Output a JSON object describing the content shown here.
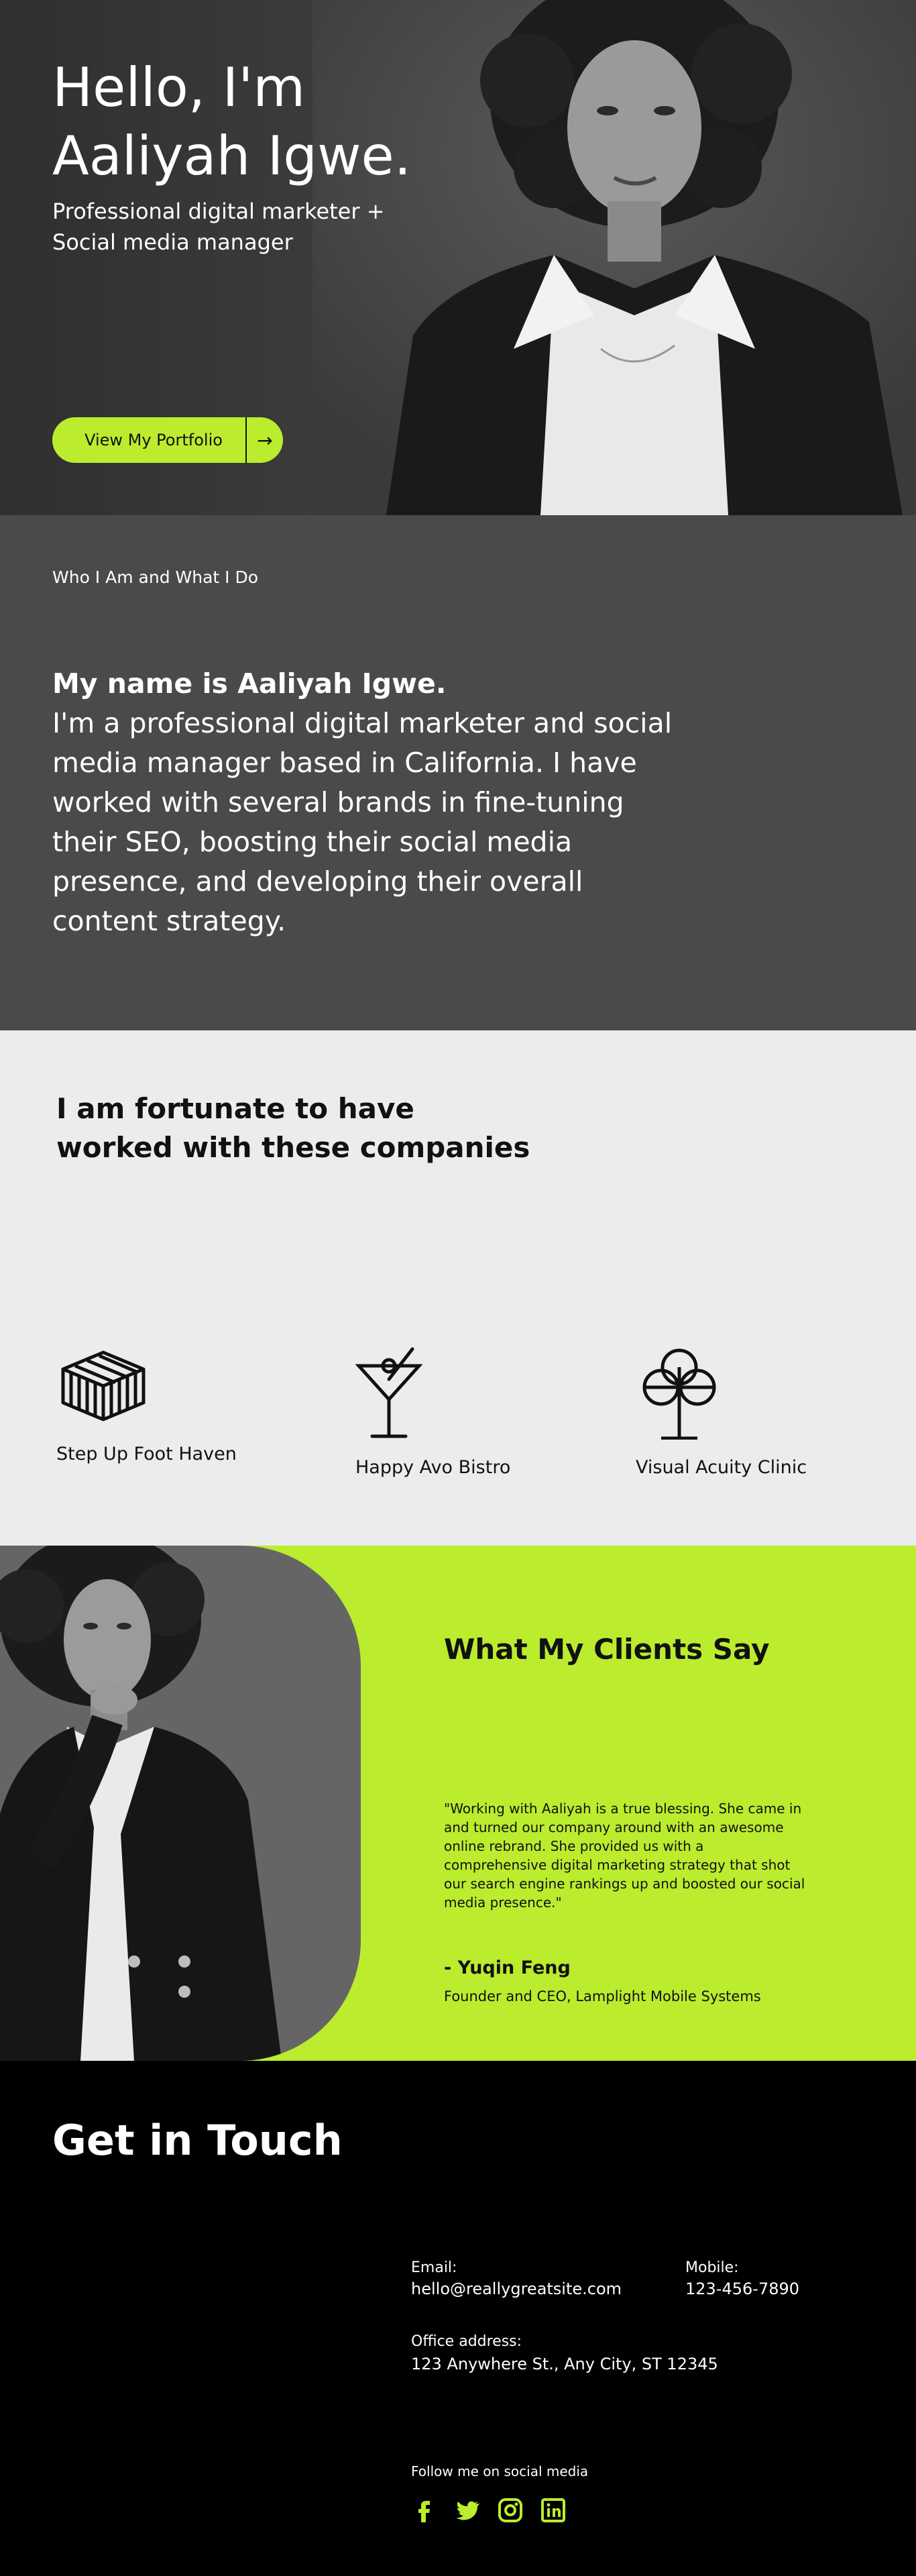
{
  "hero": {
    "title_line1": "Hello, I'm",
    "title_line2": "Aaliyah Igwe.",
    "subtitle_line1": "Professional digital marketer +",
    "subtitle_line2": "Social media manager",
    "button_label": "View My Portfolio",
    "button_arrow": "→"
  },
  "about": {
    "kicker": "Who I Am and What I Do",
    "name_line": "My name is Aaliyah Igwe.",
    "body": "I'm a professional digital marketer and social media manager based in California. I have worked with several brands in fine-tuning their SEO, boosting their social media presence, and developing their overall content strategy."
  },
  "companies": {
    "title": "I am fortunate to have worked with these companies",
    "items": [
      {
        "label": "Step Up Foot Haven",
        "icon": "striped-box-icon"
      },
      {
        "label": "Happy Avo Bistro",
        "icon": "cocktail-glass-icon"
      },
      {
        "label": "Visual Acuity Clinic",
        "icon": "clover-tree-icon"
      }
    ]
  },
  "testimonial": {
    "title": "What My Clients Say",
    "quote": "\"Working with Aaliyah is a true blessing. She came in and turned our company around with an awesome online rebrand. She provided us with a comprehensive digital marketing strategy that shot our search engine rankings up and boosted our social media presence.\"",
    "author": "- Yuqin Feng",
    "role": "Founder and CEO, Lamplight Mobile Systems"
  },
  "contact": {
    "title": "Get in Touch",
    "email_label": "Email:",
    "email_value": "hello@reallygreatsite.com",
    "mobile_label": "Mobile:",
    "mobile_value": "123-456-7890",
    "address_label": "Office address:",
    "address_value": "123 Anywhere St., Any City, ST 12345",
    "follow_label": "Follow me on social media",
    "socials": [
      "facebook-icon",
      "twitter-icon",
      "instagram-icon",
      "linkedin-icon"
    ]
  },
  "colors": {
    "accent": "#bbec2d",
    "dark": "#4a4a4a",
    "light": "#ececec",
    "black": "#000000"
  }
}
